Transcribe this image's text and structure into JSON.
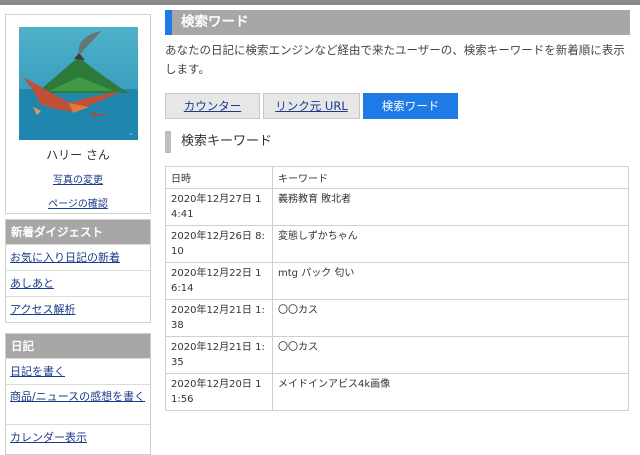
{
  "profile": {
    "name": "ハリー さん",
    "links": [
      "写真の変更",
      "ページの確認"
    ]
  },
  "sidebar": {
    "digest": {
      "title": "新着ダイジェスト",
      "items": [
        "お気に入り日記の新着",
        "あしあと",
        "アクセス解析"
      ]
    },
    "diary": {
      "title": "日記",
      "items": [
        "日記を書く",
        "商品/ニュースの感想を書く",
        "カレンダー表示"
      ]
    }
  },
  "header": {
    "title": "検索ワード"
  },
  "description": "あなたの日記に検索エンジンなど経由で来たユーザーの、検索キーワードを新着順に表示します。",
  "tabs": [
    {
      "label": "カウンター",
      "active": false
    },
    {
      "label": "リンク元 URL",
      "active": false
    },
    {
      "label": "検索ワード",
      "active": true
    }
  ],
  "section_title": "検索キーワード",
  "table": {
    "headers": [
      "日時",
      "キーワード"
    ],
    "rows": [
      [
        "2020年12月27日 14:41",
        "義務教育 敗北者"
      ],
      [
        "2020年12月26日 8:10",
        "変態しずかちゃん"
      ],
      [
        "2020年12月22日 16:14",
        "mtg パック 匂い"
      ],
      [
        "2020年12月21日 1:38",
        "〇〇カス"
      ],
      [
        "2020年12月21日 1:35",
        "〇〇カス"
      ],
      [
        "2020年12月20日 11:56",
        "メイドインアビス4k画像"
      ]
    ]
  },
  "colors": {
    "accent": "#1e7be6",
    "header_bg": "#a7a7a7",
    "link": "#1a3a8a"
  }
}
